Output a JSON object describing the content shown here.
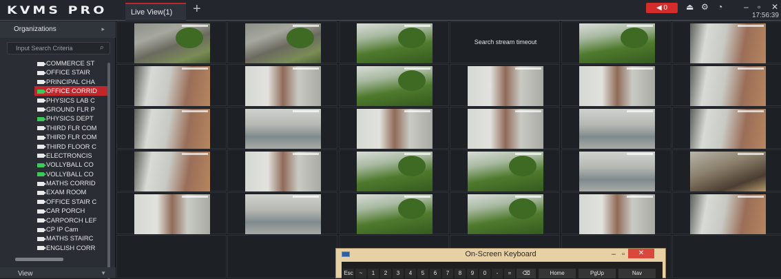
{
  "app": {
    "logo": "KVMS PRO",
    "tab_label": "Live View(1)",
    "add_tab": "+",
    "alarm_count": "0",
    "clock": "17:56:39",
    "icons": [
      "alarm-icon",
      "user-icon",
      "gear-icon",
      "dashboard-icon",
      "minimize-icon",
      "restore-icon",
      "close-icon"
    ]
  },
  "sidebar": {
    "organizations_label": "Organizations",
    "search_placeholder": "Input Search Criteria",
    "view_label": "View",
    "items": [
      {
        "label": "COMMERCE ST",
        "online": false,
        "selected": false
      },
      {
        "label": "OFFICE STAIR",
        "online": false,
        "selected": false
      },
      {
        "label": "PRINCIPAL CHA",
        "online": false,
        "selected": false
      },
      {
        "label": "OFFICE CORRID",
        "online": true,
        "selected": true
      },
      {
        "label": "PHYSICS LAB C",
        "online": false,
        "selected": false
      },
      {
        "label": "GROUND FLR P",
        "online": false,
        "selected": false
      },
      {
        "label": "PHYSICS DEPT",
        "online": true,
        "selected": false
      },
      {
        "label": "THIRD FLR COM",
        "online": false,
        "selected": false
      },
      {
        "label": "THIRD FLR COM",
        "online": false,
        "selected": false
      },
      {
        "label": "THIRD FLOOR C",
        "online": false,
        "selected": false
      },
      {
        "label": "ELECTRONCIS",
        "online": false,
        "selected": false
      },
      {
        "label": "VOLLYBALL CO",
        "online": true,
        "selected": false
      },
      {
        "label": "VOLLYBALL CO",
        "online": true,
        "selected": false
      },
      {
        "label": "MATHS CORRID",
        "online": false,
        "selected": false
      },
      {
        "label": "EXAM ROOM",
        "online": false,
        "selected": false
      },
      {
        "label": "OFFICE STAIR C",
        "online": false,
        "selected": false
      },
      {
        "label": "CAR PORCH",
        "online": false,
        "selected": false
      },
      {
        "label": "CARPORCH LEF",
        "online": false,
        "selected": false
      },
      {
        "label": "CP IP Cam",
        "online": false,
        "selected": false
      },
      {
        "label": "MATHS STAIRC",
        "online": false,
        "selected": false
      },
      {
        "label": "ENGLISH CORR",
        "online": false,
        "selected": false
      }
    ]
  },
  "grid": {
    "timeout_message": "Search stream timeout"
  },
  "keyboard": {
    "title": "On-Screen Keyboard",
    "keys": [
      "Esc",
      "~",
      "1",
      "2",
      "3",
      "4",
      "5",
      "6",
      "7",
      "8",
      "9",
      "0",
      "-",
      "=",
      "⌫",
      "Home",
      "PgUp",
      "Nav"
    ]
  },
  "colors": {
    "accent": "#c0272d",
    "online": "#3cc957",
    "background": "#1b1e23"
  }
}
